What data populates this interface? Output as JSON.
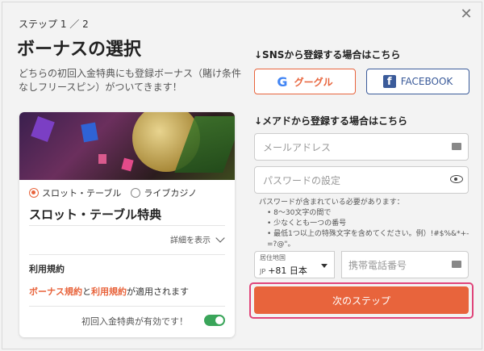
{
  "header": {
    "step": "ステップ 1 ／ 2",
    "title": "ボーナスの選択",
    "description": "どちらの初回入金特典にも登録ボーナス（賭け条件なしフリースピン）がついてきます！"
  },
  "bonus_card": {
    "options": [
      "スロット・テーブル",
      "ライブカジノ"
    ],
    "selected": "スロット・テーブル",
    "title": "スロット・テーブル特典",
    "details_label": "詳細を表示",
    "terms_heading": "利用規約",
    "terms_link1": "ボーナス規約",
    "terms_and": "と",
    "terms_link2": "利用規約",
    "terms_suffix": "が適用されます",
    "valid_label": "初回入金特典が有効です！",
    "toggle_on": true
  },
  "sns": {
    "heading": "↓SNSから登録する場合はこちら",
    "google_label": "グーグル",
    "facebook_label": "FACEBOOK"
  },
  "mail": {
    "heading": "↓メアドから登録する場合はこちら",
    "email_placeholder": "メールアドレス",
    "password_placeholder": "パスワードの設定",
    "password_hint_title": "パスワードが含まれている必要があります：",
    "password_hints": [
      "8〜30文字の間で",
      "少なくとも一つの番号",
      "最低1つ以上の特殊文字を含めてください。例）!#$%&*+-=?@\"。"
    ],
    "country_label": "居住地国",
    "country_code": "JP",
    "country_value": "+81 日本",
    "phone_placeholder": "携帯電話番号",
    "next_label": "次のステップ"
  },
  "colors": {
    "accent": "#e8643c",
    "facebook": "#3b5b9a",
    "highlight": "#e0457a",
    "toggle": "#3aa55a"
  }
}
